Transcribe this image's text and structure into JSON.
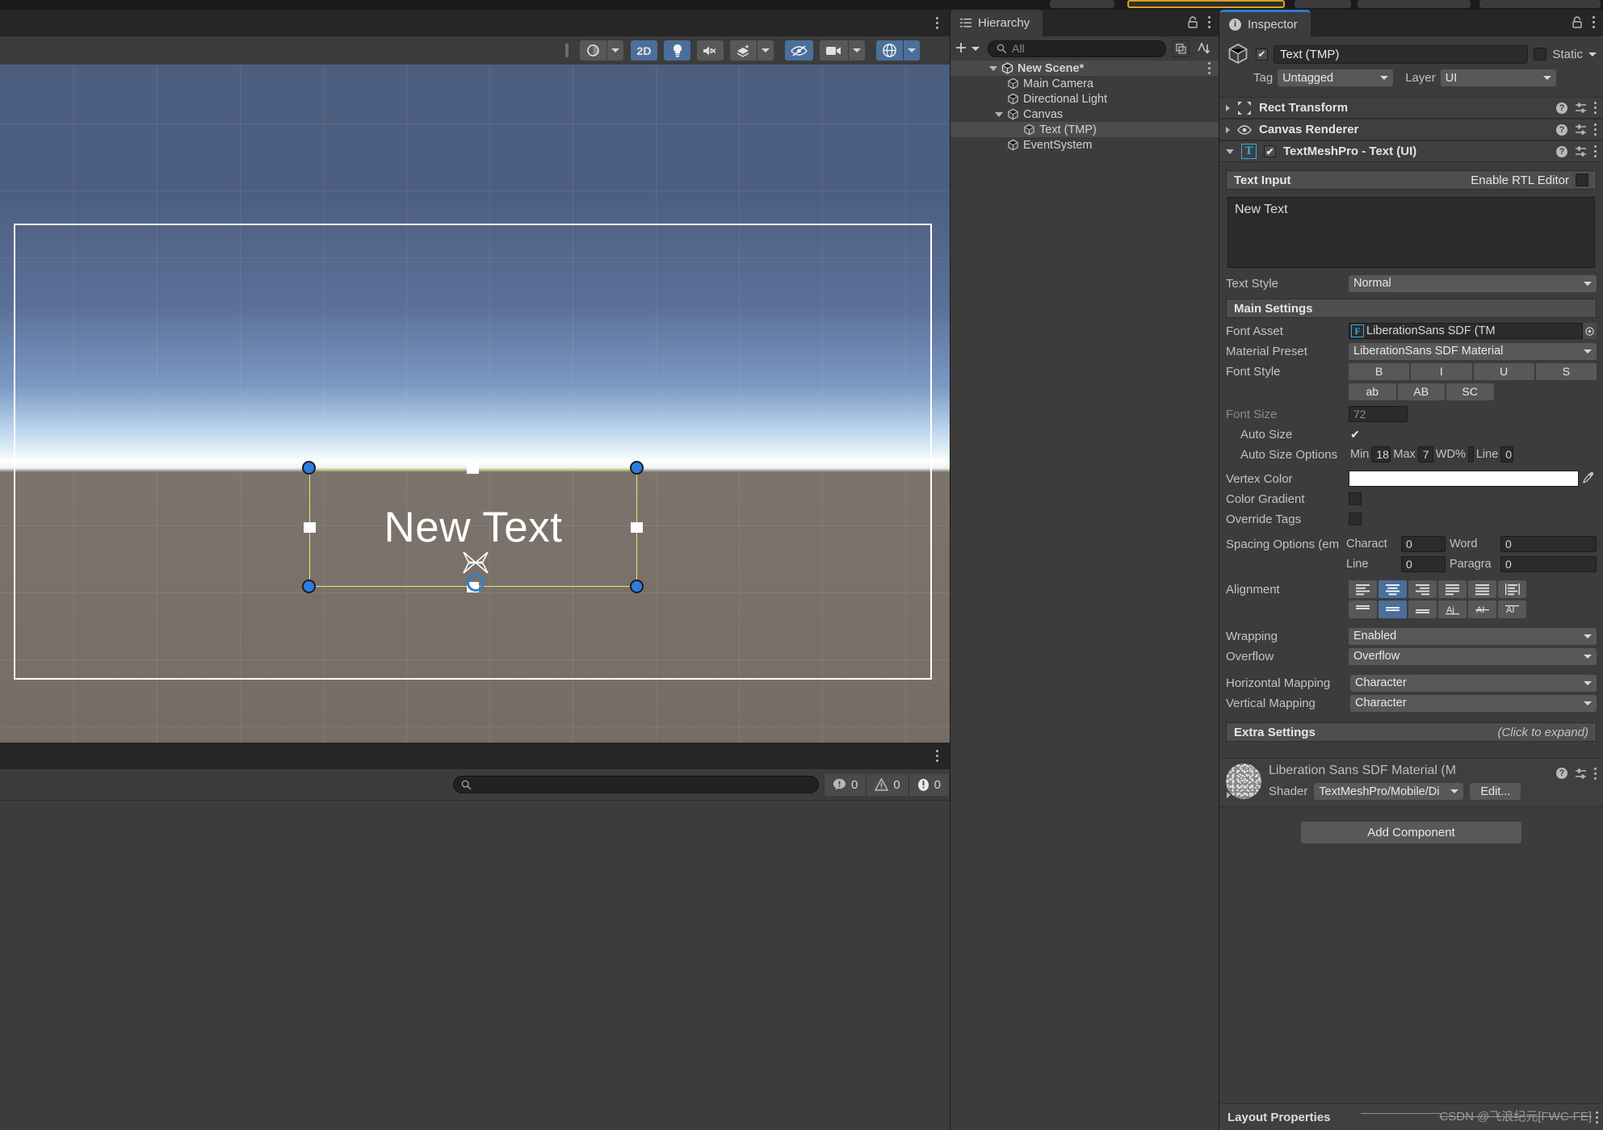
{
  "scene_view": {
    "toolbar": {
      "draw_mode_label": "shading-mode",
      "two_d_label": "2D",
      "light_icon": "lightbulb-icon",
      "audio_icon": "audio-mute-icon",
      "fx_icon": "effects-icon",
      "hidden_icon": "hidden-objects-icon",
      "camera_icon": "scene-camera-icon",
      "gizmos_icon": "gizmos-icon"
    },
    "selected_object_text": "New Text"
  },
  "console": {
    "search_placeholder": "",
    "counts": {
      "log": "0",
      "warning": "0",
      "error": "0"
    }
  },
  "hierarchy": {
    "tab_label": "Hierarchy",
    "search_placeholder": "All",
    "add_label": "+",
    "items": [
      {
        "label": "New Scene*",
        "depth": 0,
        "expandable": true,
        "selected": false,
        "is_scene": true
      },
      {
        "label": "Main Camera",
        "depth": 1,
        "expandable": false,
        "selected": false,
        "is_scene": false
      },
      {
        "label": "Directional Light",
        "depth": 1,
        "expandable": false,
        "selected": false,
        "is_scene": false
      },
      {
        "label": "Canvas",
        "depth": 1,
        "expandable": true,
        "selected": false,
        "is_scene": false
      },
      {
        "label": "Text (TMP)",
        "depth": 2,
        "expandable": false,
        "selected": true,
        "is_scene": false
      },
      {
        "label": "EventSystem",
        "depth": 1,
        "expandable": false,
        "selected": false,
        "is_scene": false
      }
    ]
  },
  "inspector": {
    "tab_label": "Inspector",
    "object_name": "Text (TMP)",
    "static_label": "Static",
    "tag_label": "Tag",
    "tag_value": "Untagged",
    "layer_label": "Layer",
    "layer_value": "UI",
    "components": [
      {
        "name": "Rect Transform",
        "expanded": false,
        "has_enable_checkbox": false
      },
      {
        "name": "Canvas Renderer",
        "expanded": false,
        "has_enable_checkbox": false
      },
      {
        "name": "TextMeshPro - Text (UI)",
        "expanded": true,
        "has_enable_checkbox": true
      }
    ],
    "text_input_header": "Text Input",
    "enable_rtl_label": "Enable RTL Editor",
    "text_value": "New Text",
    "text_style_label": "Text Style",
    "text_style_value": "Normal",
    "main_settings_label": "Main Settings",
    "font_asset_label": "Font Asset",
    "font_asset_value": "LiberationSans SDF (TM",
    "material_preset_label": "Material Preset",
    "material_preset_value": "LiberationSans SDF Material",
    "font_style_label": "Font Style",
    "font_style_buttons_row1": [
      "B",
      "I",
      "U",
      "S"
    ],
    "font_style_buttons_row2": [
      "ab",
      "AB",
      "SC"
    ],
    "font_size_label": "Font Size",
    "font_size_value": "72",
    "auto_size_label": "Auto Size",
    "auto_size_checked": true,
    "auto_size_options_label": "Auto Size Options",
    "auto_min_label": "Min",
    "auto_min_value": "18",
    "auto_max_label": "Max",
    "auto_max_value": "7",
    "auto_wd_label": "WD%",
    "auto_wd_value": "",
    "auto_line_label": "Line",
    "auto_line_value": "0",
    "vertex_color_label": "Vertex Color",
    "vertex_color_value": "#FFFFFF",
    "color_gradient_label": "Color Gradient",
    "override_tags_label": "Override Tags",
    "spacing_options_label": "Spacing Options (em",
    "spacing_character_label": "Charact",
    "spacing_character_value": "0",
    "spacing_word_label": "Word",
    "spacing_word_value": "0",
    "spacing_line_label": "Line",
    "spacing_line_value": "0",
    "spacing_paragraph_label": "Paragra",
    "spacing_paragraph_value": "0",
    "alignment_label": "Alignment",
    "alignment_h_active_index": 1,
    "alignment_v_active_index": 1,
    "wrapping_label": "Wrapping",
    "wrapping_value": "Enabled",
    "overflow_label": "Overflow",
    "overflow_value": "Overflow",
    "horizontal_mapping_label": "Horizontal Mapping",
    "horizontal_mapping_value": "Character",
    "vertical_mapping_label": "Vertical Mapping",
    "vertical_mapping_value": "Character",
    "extra_settings_label": "Extra Settings",
    "extra_settings_hint": "(Click to expand)",
    "material_name": "Liberation Sans SDF Material (M",
    "shader_label": "Shader",
    "shader_value": "TextMeshPro/Mobile/Di",
    "shader_edit_label": "Edit...",
    "add_component_label": "Add Component",
    "layout_properties_label": "Layout Properties",
    "watermark": "CSDN @飞浪纪元[FWC-FE]"
  },
  "colors": {
    "accent_blue": "#4a6f9b",
    "selection_yellow": "#e8e86a",
    "panel_bg": "#3c3c3c",
    "tab_bg": "#262626",
    "tab_active_blue": "#2c79d4"
  }
}
